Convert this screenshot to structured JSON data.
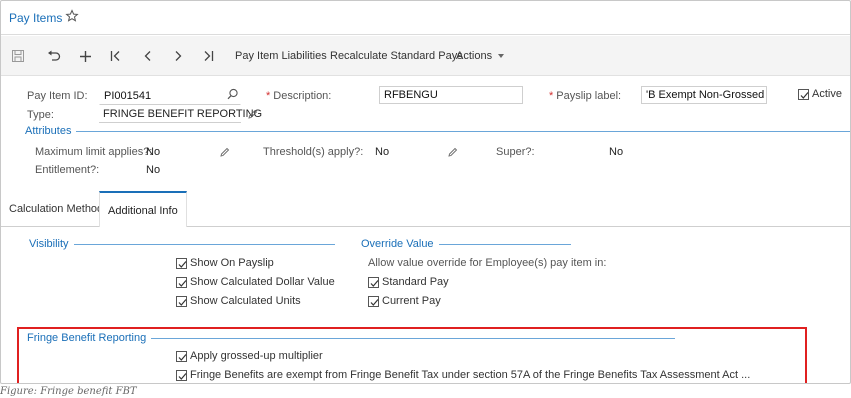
{
  "window": {
    "title": "Pay Items"
  },
  "toolbar": {
    "pay_item_liabilities": "Pay Item Liabilities",
    "recalculate_standard_pays": "Recalculate Standard Pays",
    "actions": "Actions"
  },
  "form": {
    "pay_item_id_label": "Pay Item ID:",
    "pay_item_id_value": "PI001541",
    "type_label": "Type:",
    "type_value": "FRINGE BENEFIT REPORTING",
    "description_label": "Description:",
    "description_value": "RFBENGU",
    "payslip_label_label": "Payslip label:",
    "payslip_label_value": "'B Exempt Non-Grossed UP",
    "active_label": "Active",
    "active_checked": true
  },
  "attributes": {
    "title": "Attributes",
    "maximum_limit_label": "Maximum limit applies?:",
    "maximum_limit_value": "No",
    "entitlement_label": "Entitlement?:",
    "entitlement_value": "No",
    "threshold_label": "Threshold(s) apply?:",
    "threshold_value": "No",
    "super_label": "Super?:",
    "super_value": "No"
  },
  "tabs": [
    {
      "label": "Calculation Method",
      "active": false
    },
    {
      "label": "Additional Info",
      "active": true
    }
  ],
  "visibility": {
    "title": "Visibility",
    "items": [
      {
        "label": "Show On Payslip",
        "checked": true
      },
      {
        "label": "Show Calculated Dollar Value",
        "checked": true
      },
      {
        "label": "Show Calculated Units",
        "checked": true
      }
    ]
  },
  "override": {
    "title": "Override Value",
    "description": "Allow value override for Employee(s) pay item in:",
    "items": [
      {
        "label": "Standard Pay",
        "checked": true
      },
      {
        "label": "Current Pay",
        "checked": true
      }
    ]
  },
  "fringe": {
    "title": "Fringe Benefit Reporting",
    "items": [
      {
        "label": "Apply grossed-up multiplier",
        "checked": true
      },
      {
        "label": "Fringe Benefits are exempt from Fringe Benefit Tax under section 57A of the Fringe Benefits Tax Assessment Act ...",
        "checked": true
      }
    ]
  },
  "caption": "Figure: Fringe benefit FBT",
  "colors": {
    "accent": "#1a6fb8",
    "required": "#d32f2f",
    "highlight": "#e02020"
  }
}
